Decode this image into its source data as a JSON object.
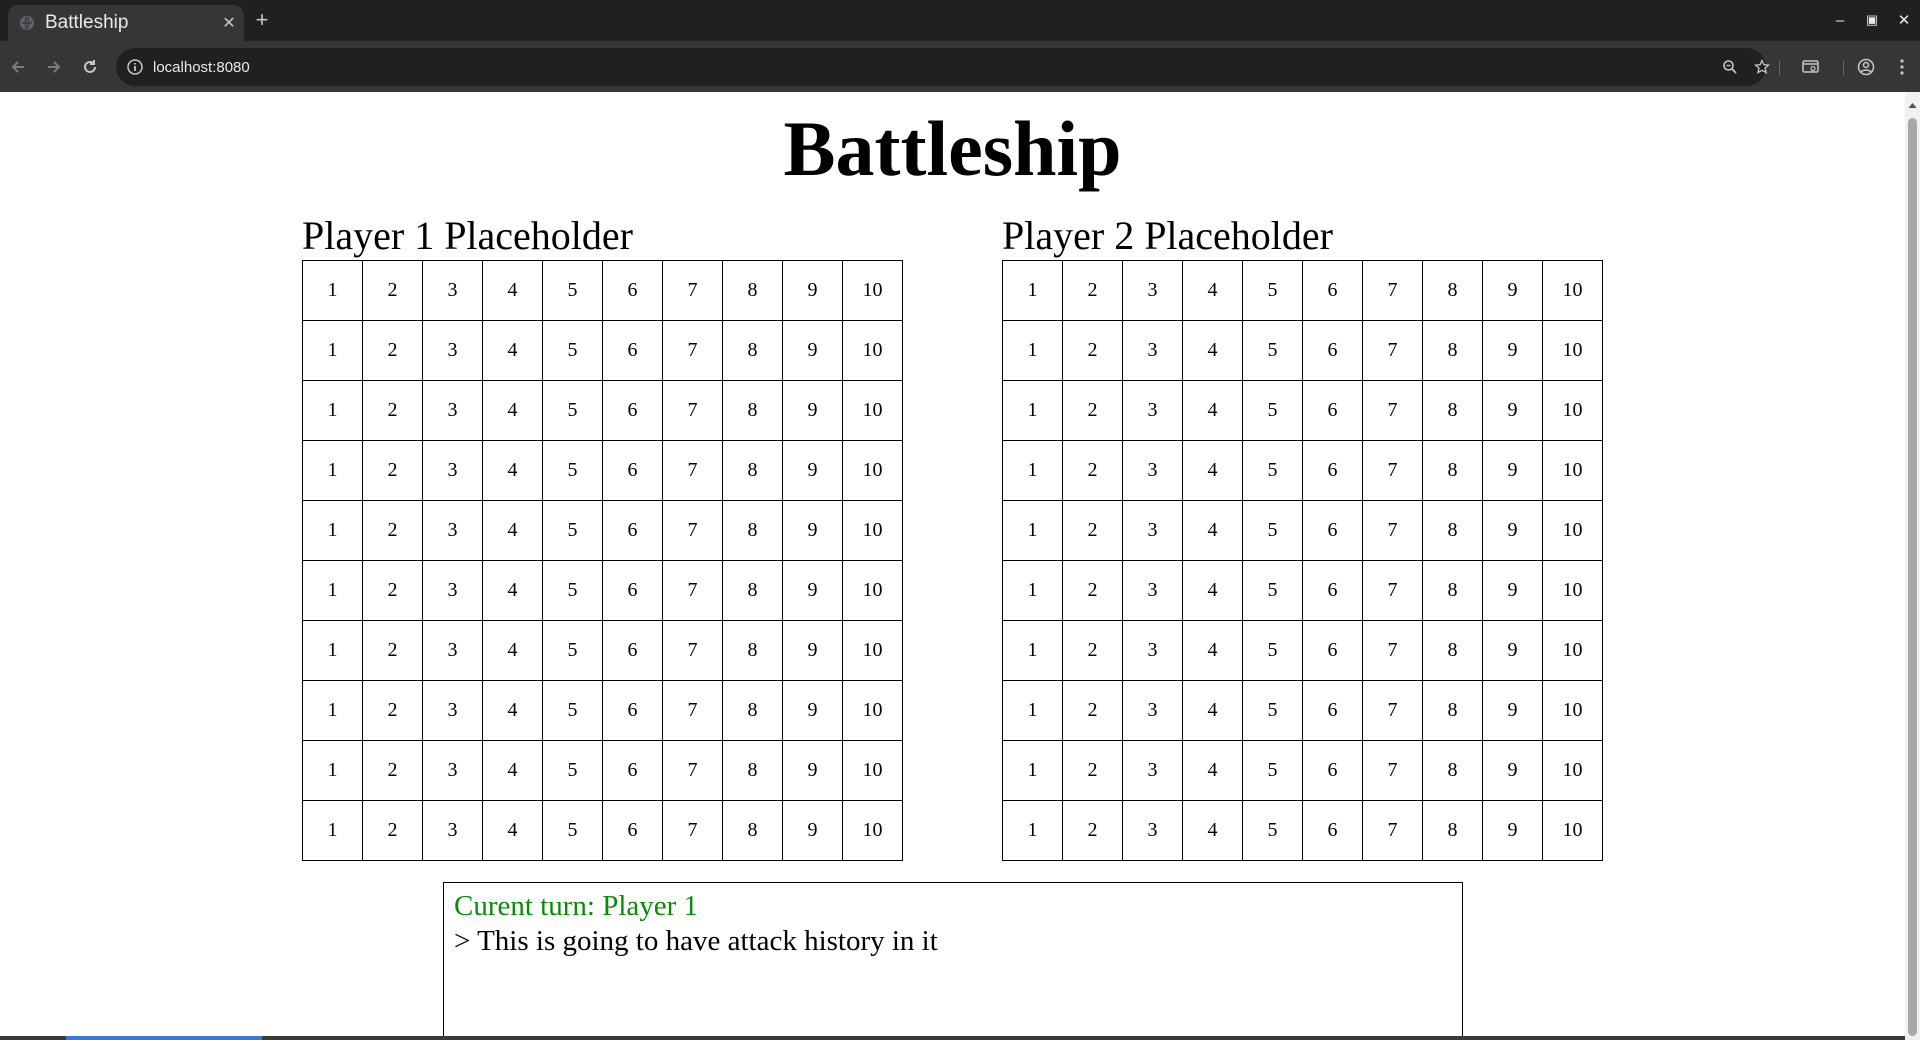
{
  "browser": {
    "tab_title": "Battleship",
    "tab_close": "✕",
    "new_tab": "+",
    "url": "localhost:8080",
    "window_controls": {
      "minimize": "–",
      "maximize": "▣",
      "close": "✕"
    }
  },
  "page": {
    "title": "Battleship",
    "player1": {
      "name": "Player 1 Placeholder",
      "rows": [
        [
          "1",
          "2",
          "3",
          "4",
          "5",
          "6",
          "7",
          "8",
          "9",
          "10"
        ],
        [
          "1",
          "2",
          "3",
          "4",
          "5",
          "6",
          "7",
          "8",
          "9",
          "10"
        ],
        [
          "1",
          "2",
          "3",
          "4",
          "5",
          "6",
          "7",
          "8",
          "9",
          "10"
        ],
        [
          "1",
          "2",
          "3",
          "4",
          "5",
          "6",
          "7",
          "8",
          "9",
          "10"
        ],
        [
          "1",
          "2",
          "3",
          "4",
          "5",
          "6",
          "7",
          "8",
          "9",
          "10"
        ],
        [
          "1",
          "2",
          "3",
          "4",
          "5",
          "6",
          "7",
          "8",
          "9",
          "10"
        ],
        [
          "1",
          "2",
          "3",
          "4",
          "5",
          "6",
          "7",
          "8",
          "9",
          "10"
        ],
        [
          "1",
          "2",
          "3",
          "4",
          "5",
          "6",
          "7",
          "8",
          "9",
          "10"
        ],
        [
          "1",
          "2",
          "3",
          "4",
          "5",
          "6",
          "7",
          "8",
          "9",
          "10"
        ],
        [
          "1",
          "2",
          "3",
          "4",
          "5",
          "6",
          "7",
          "8",
          "9",
          "10"
        ]
      ]
    },
    "player2": {
      "name": "Player 2 Placeholder",
      "rows": [
        [
          "1",
          "2",
          "3",
          "4",
          "5",
          "6",
          "7",
          "8",
          "9",
          "10"
        ],
        [
          "1",
          "2",
          "3",
          "4",
          "5",
          "6",
          "7",
          "8",
          "9",
          "10"
        ],
        [
          "1",
          "2",
          "3",
          "4",
          "5",
          "6",
          "7",
          "8",
          "9",
          "10"
        ],
        [
          "1",
          "2",
          "3",
          "4",
          "5",
          "6",
          "7",
          "8",
          "9",
          "10"
        ],
        [
          "1",
          "2",
          "3",
          "4",
          "5",
          "6",
          "7",
          "8",
          "9",
          "10"
        ],
        [
          "1",
          "2",
          "3",
          "4",
          "5",
          "6",
          "7",
          "8",
          "9",
          "10"
        ],
        [
          "1",
          "2",
          "3",
          "4",
          "5",
          "6",
          "7",
          "8",
          "9",
          "10"
        ],
        [
          "1",
          "2",
          "3",
          "4",
          "5",
          "6",
          "7",
          "8",
          "9",
          "10"
        ],
        [
          "1",
          "2",
          "3",
          "4",
          "5",
          "6",
          "7",
          "8",
          "9",
          "10"
        ],
        [
          "1",
          "2",
          "3",
          "4",
          "5",
          "6",
          "7",
          "8",
          "9",
          "10"
        ]
      ]
    },
    "log": {
      "turn_text": "Curent turn: Player 1",
      "turn_color": "#0a8a0a",
      "history": [
        "> This is going to have attack history in it"
      ]
    }
  }
}
